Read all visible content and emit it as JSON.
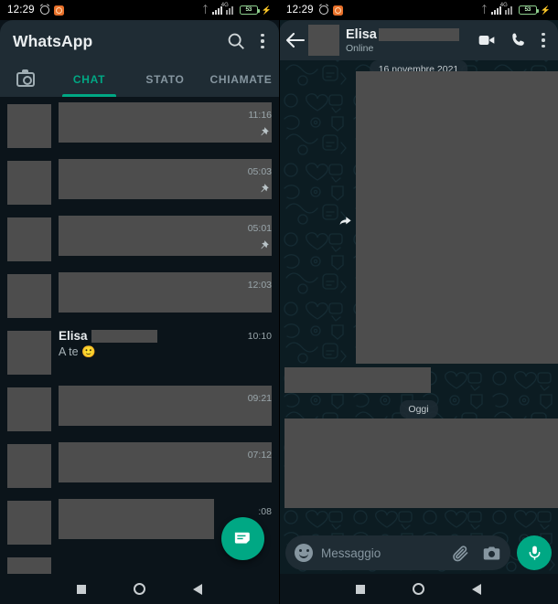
{
  "status_bar": {
    "time": "12:29",
    "icons_left": [
      "alarm-icon",
      "app-notification-icon"
    ],
    "icons_right": [
      "bluetooth-icon",
      "signal-1-icon",
      "signal-2-icon",
      "battery-icon",
      "charging-bolt-icon"
    ],
    "battery_level": "53"
  },
  "left_panel": {
    "header": {
      "title": "WhatsApp",
      "search_icon": "search-icon",
      "menu_icon": "more-vert-icon"
    },
    "tabs": [
      {
        "label": "CHAT",
        "active": true
      },
      {
        "label": "STATO",
        "active": false
      },
      {
        "label": "CHIAMATE",
        "active": false
      }
    ],
    "camera_tab_icon": "camera-icon",
    "chats": [
      {
        "name": "",
        "message": "",
        "time": "11:16",
        "pinned": true,
        "redacted": true
      },
      {
        "name": "",
        "message": "",
        "time": "05:03",
        "pinned": true,
        "redacted": true
      },
      {
        "name": "",
        "message": "",
        "time": "05:01",
        "pinned": true,
        "redacted": true
      },
      {
        "name": "",
        "message": "",
        "time": "12:03",
        "pinned": false,
        "redacted": true
      },
      {
        "name": "Elisa",
        "message": "A te 🙂",
        "time": "10:10",
        "pinned": false,
        "redacted": false
      },
      {
        "name": "",
        "message": "",
        "time": "09:21",
        "pinned": false,
        "redacted": true
      },
      {
        "name": "",
        "message": "",
        "time": "07:12",
        "pinned": false,
        "redacted": true
      },
      {
        "name": "",
        "message": "",
        "time": ":08",
        "pinned": false,
        "redacted": true
      }
    ],
    "fab": {
      "icon": "new-chat-icon",
      "color": "#00a884"
    }
  },
  "right_panel": {
    "header": {
      "back_icon": "back-arrow-icon",
      "contact_name": "Elisa",
      "status": "Online",
      "video_icon": "video-call-icon",
      "call_icon": "phone-call-icon",
      "menu_icon": "more-vert-icon"
    },
    "date_chips": [
      {
        "label": "16 novembre 2021"
      },
      {
        "label": "Oggi"
      }
    ],
    "forward_icon": "forward-arrow-icon",
    "input": {
      "placeholder": "Messaggio",
      "emoji_icon": "emoji-icon",
      "attach_icon": "attach-clip-icon",
      "camera_icon": "camera-icon",
      "mic_icon": "microphone-icon"
    }
  },
  "nav_bar": {
    "recents": "square-recents-icon",
    "home": "circle-home-icon",
    "back": "triangle-back-icon"
  },
  "colors": {
    "accent": "#00a884",
    "header_bg": "#1f2c34",
    "app_bg": "#0b141a",
    "redaction": "#4d4d4d"
  }
}
